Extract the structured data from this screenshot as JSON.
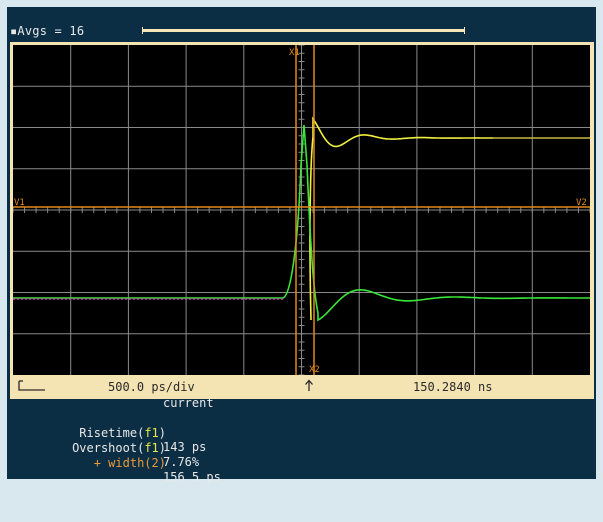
{
  "header": {
    "avgs_label": "▪Avgs = 16",
    "progress": 1.0
  },
  "plot": {
    "marker_v1": "V1",
    "marker_v2": "V2",
    "marker_x1": "X1",
    "marker_x2": "X2",
    "colors": {
      "grid": "#8a8a8a",
      "background": "#000000",
      "trace_yellow": "#f0f040",
      "trace_green": "#39e639",
      "trace_magenta": "#e030c8",
      "marker": "#e38a1f",
      "frame": "#f4e4b3"
    }
  },
  "statusbar": {
    "left_icon": "step-waveform-icon",
    "timebase": "500.0 ps/div",
    "trigger_icon": "up-arrow-icon",
    "position": "150.2840 ns"
  },
  "measurements": {
    "column_header": "current",
    "rows": [
      {
        "name": "Risetime(",
        "tag": "f1",
        "close": ")",
        "value": "143 ps"
      },
      {
        "name": "Overshoot(",
        "tag": "f1",
        "close": ")",
        "value": "7.76%"
      },
      {
        "name": "+ width(",
        "tag": "2",
        "close": ")",
        "value": "156.5 ps"
      }
    ]
  }
}
